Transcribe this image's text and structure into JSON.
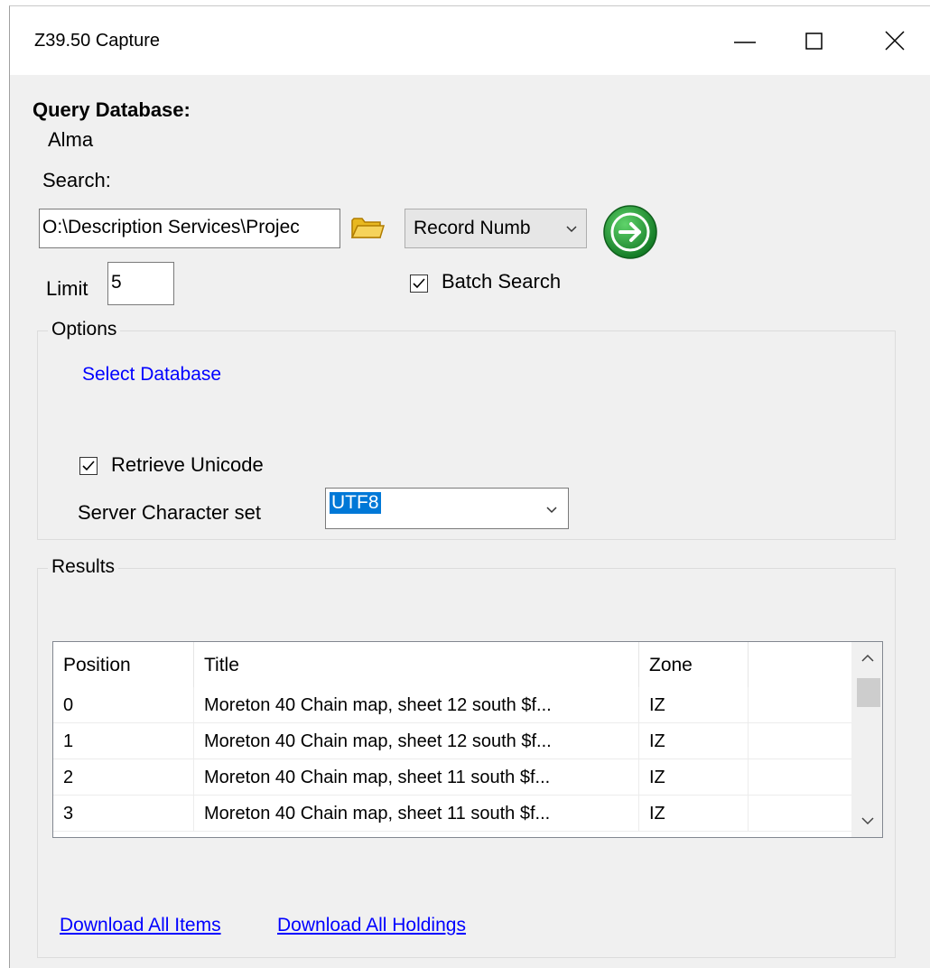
{
  "window": {
    "title": "Z39.50 Capture"
  },
  "query": {
    "label": "Query Database:",
    "value": "Alma"
  },
  "search": {
    "label": "Search:",
    "path_value": "O:\\Description Services\\Projec",
    "field_selected": "Record Numb",
    "limit_label": "Limit",
    "limit_value": "5",
    "batch_label": "Batch Search",
    "batch_checked": true
  },
  "options": {
    "title": "Options",
    "select_db_link": "Select Database",
    "retrieve_unicode_label": "Retrieve Unicode",
    "retrieve_unicode_checked": true,
    "charset_label": "Server Character set",
    "charset_value": "UTF8"
  },
  "results": {
    "title": "Results",
    "columns": [
      "Position",
      "Title",
      "Zone"
    ],
    "rows": [
      {
        "position": "0",
        "title": "Moreton 40 Chain map, sheet 12 south $f...",
        "zone": "IZ"
      },
      {
        "position": "1",
        "title": "Moreton 40 Chain map, sheet 12 south $f...",
        "zone": "IZ"
      },
      {
        "position": "2",
        "title": "Moreton 40 Chain map, sheet 11 south $f...",
        "zone": "IZ"
      },
      {
        "position": "3",
        "title": "Moreton 40 Chain map, sheet 11 south $f...",
        "zone": "IZ"
      }
    ],
    "download_items_link": "Download All Items",
    "download_holdings_link": "Download All Holdings"
  },
  "icons": {
    "minimize": "minimize-icon",
    "maximize": "maximize-icon",
    "close": "close-icon",
    "folder": "folder-icon",
    "go": "go-arrow-icon",
    "dropdown": "chevron-down-icon"
  },
  "colors": {
    "link": "#0000ff",
    "go_button": "#1e9b32",
    "selection": "#0078d7"
  }
}
